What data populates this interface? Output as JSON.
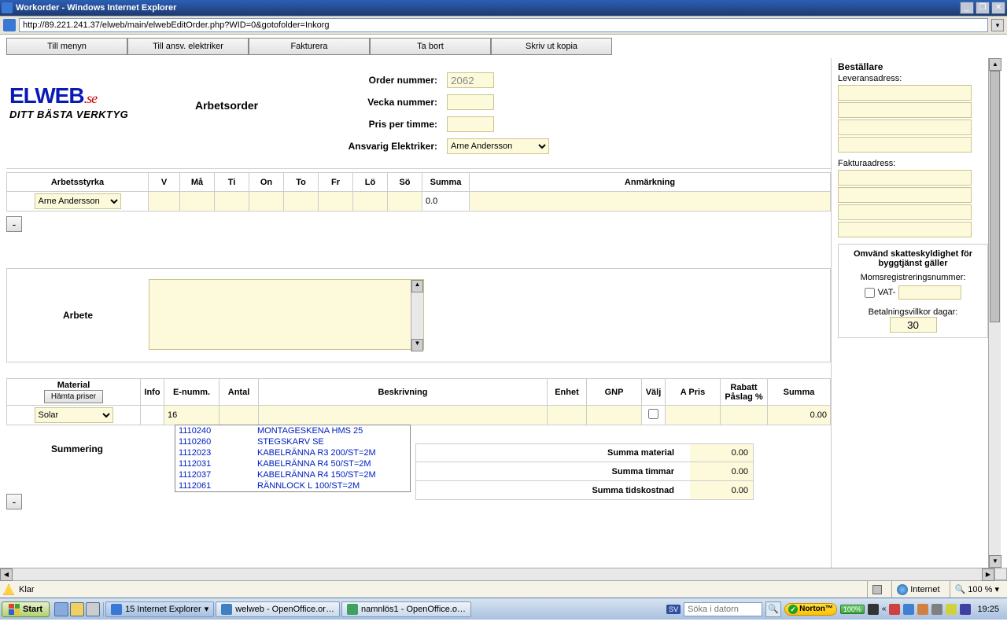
{
  "window": {
    "title": "Workorder - Windows Internet Explorer"
  },
  "url": "http://89.221.241.37/elweb/main/elwebEditOrder.php?WID=0&gotofolder=Inkorg",
  "toolbar": {
    "menu": "Till menyn",
    "ansv": "Till ansv. elektriker",
    "fakt": "Fakturera",
    "tabort": "Ta bort",
    "skriv": "Skriv ut kopia"
  },
  "logo": {
    "brand": "ELWEB",
    "tld": ".se",
    "tag": "DITT BÄSTA VERKTYG"
  },
  "page_title": "Arbetsorder",
  "order": {
    "num_lbl": "Order nummer:",
    "num_val": "2062",
    "vecka_lbl": "Vecka nummer:",
    "vecka_val": "",
    "pris_lbl": "Pris per timme:",
    "pris_val": "",
    "ansv_lbl": "Ansvarig Elektriker:",
    "ansv_sel": "Arne Andersson"
  },
  "wf": {
    "hdr": {
      "arb": "Arbetsstyrka",
      "v": "V",
      "ma": "Må",
      "ti": "Ti",
      "on": "On",
      "to": "To",
      "fr": "Fr",
      "lo": "Lö",
      "so": "Sö",
      "sum": "Summa",
      "anm": "Anmärkning"
    },
    "row": {
      "name": "Arne Andersson",
      "sum": "0.0"
    },
    "minus": "-"
  },
  "arbete": {
    "lbl": "Arbete"
  },
  "material": {
    "hdr": {
      "mat": "Material",
      "hamta": "Hämta priser",
      "info": "Info",
      "enumm": "E-numm.",
      "antal": "Antal",
      "besk": "Beskrivning",
      "enhet": "Enhet",
      "gnp": "GNP",
      "valj": "Välj",
      "apris": "A Pris",
      "rabatt": "Rabatt Påslag %",
      "summa": "Summa"
    },
    "supplier": "Solar",
    "enumm_input": "16",
    "row_summa": "0.00",
    "minus": "-"
  },
  "ac": [
    {
      "code": "1110240",
      "desc": "MONTAGESKENA HMS 25"
    },
    {
      "code": "1110260",
      "desc": "STEGSKARV SE"
    },
    {
      "code": "1112023",
      "desc": "KABELRÄNNA R3 200/ST=2M"
    },
    {
      "code": "1112031",
      "desc": "KABELRÄNNA R4 50/ST=2M"
    },
    {
      "code": "1112037",
      "desc": "KABELRÄNNA R4 150/ST=2M"
    },
    {
      "code": "1112061",
      "desc": "RÄNNLOCK L 100/ST=2M"
    }
  ],
  "summering": {
    "lbl": "Summering",
    "mat": "Summa material",
    "mat_v": "0.00",
    "tim": "Summa timmar",
    "tim_v": "0.00",
    "tid": "Summa tidskostnad",
    "tid_v": "0.00"
  },
  "rcol": {
    "best": "Beställare",
    "lev": "Leveransadress:",
    "fakt": "Fakturaadress:",
    "omv": "Omvänd skatteskyldighet för byggtjänst gäller",
    "moms": "Momsregistreringsnummer:",
    "vat": "VAT-",
    "betal": "Betalningsvillkor dagar:",
    "betal_v": "30"
  },
  "status": {
    "klar": "Klar",
    "internet": "Internet",
    "zoom": "100 %"
  },
  "taskbar": {
    "start": "Start",
    "t1": "15 Internet Explorer",
    "t2": "welweb - OpenOffice.or…",
    "t3": "namnlös1 - OpenOffice.o…",
    "search_ph": "Söka i datorn",
    "norton": "Norton™",
    "battery": "100%",
    "clock": "19:25"
  }
}
